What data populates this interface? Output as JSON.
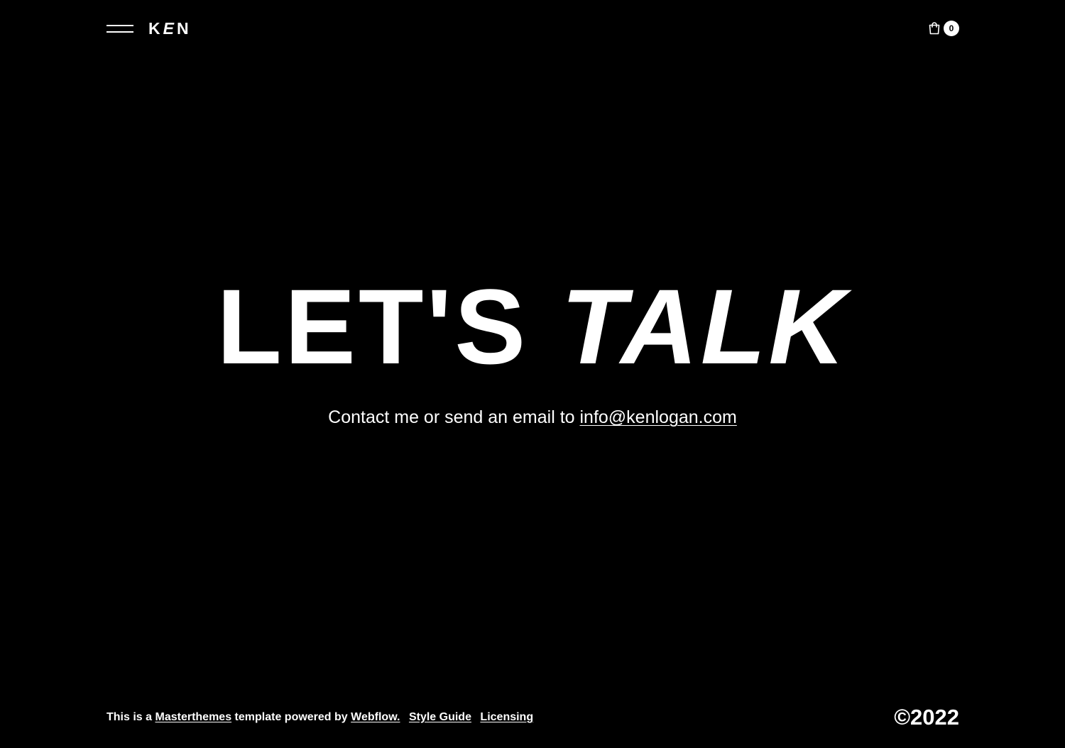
{
  "header": {
    "menu_icon": "hamburger-icon",
    "logo_text": "KEN",
    "logo_parts": [
      "K",
      "E",
      "N"
    ],
    "cart_icon": "shopping-bag-icon",
    "cart_count": "0"
  },
  "hero": {
    "title_part1": "LET'S",
    "title_part2": "TALK",
    "subtitle_prefix": "Contact me or send an email to",
    "email": "info@kenlogan.com"
  },
  "footer": {
    "credit_prefix": "This is a",
    "credit_link_1": "Masterthemes",
    "credit_middle": "template powered by",
    "credit_link_2": "Webflow.",
    "style_guide": "Style Guide",
    "licensing": "Licensing",
    "copyright": "©2022"
  },
  "colors": {
    "background": "#000000",
    "foreground": "#ffffff"
  }
}
